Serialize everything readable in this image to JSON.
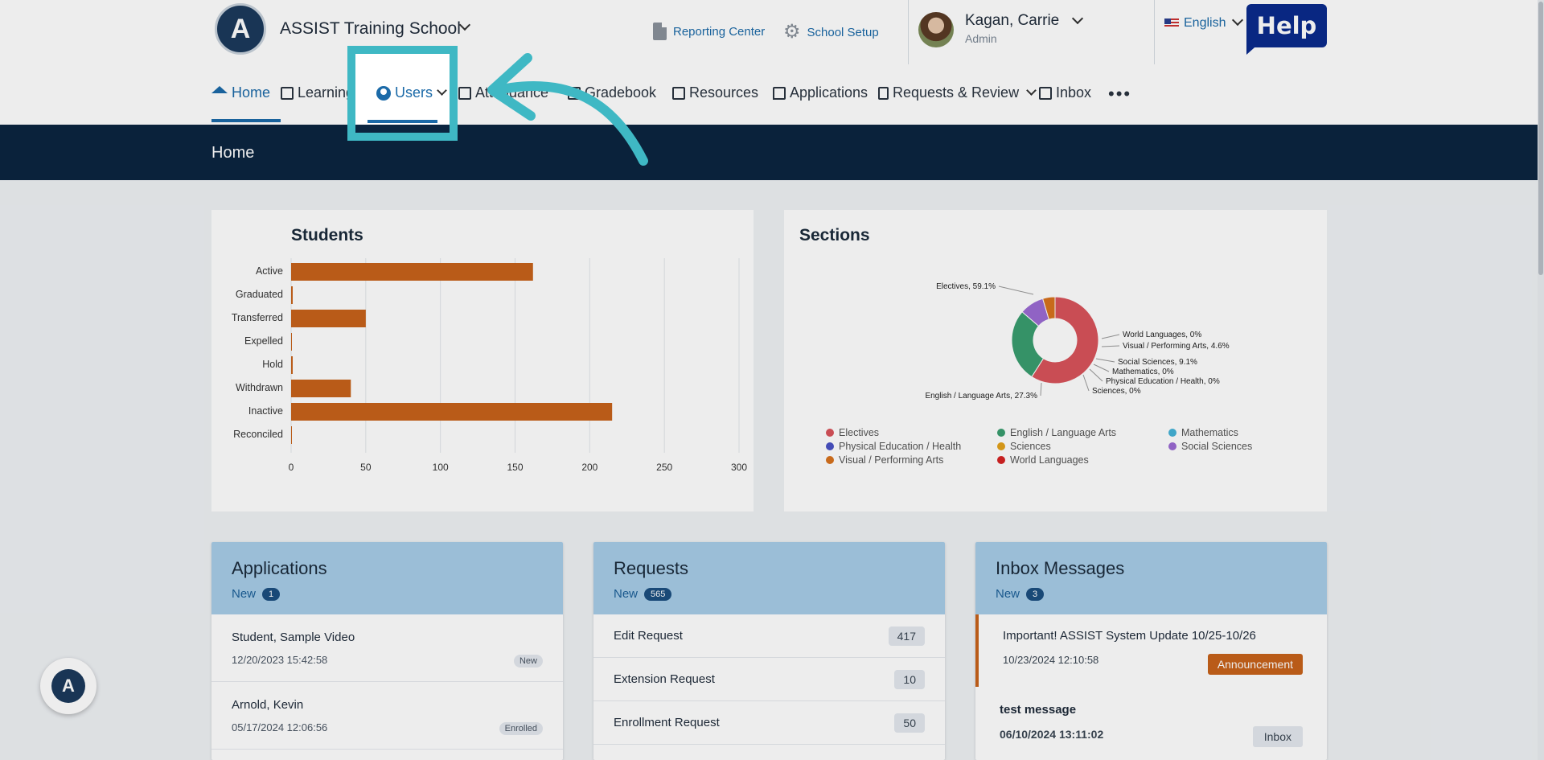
{
  "header": {
    "logo_letter": "A",
    "school_name": "ASSIST Training School",
    "reporting_center": "Reporting Center",
    "school_setup": "School Setup",
    "user_name": "Kagan, Carrie",
    "user_role": "Admin",
    "language": "English",
    "help": "Help"
  },
  "nav": {
    "home": "Home",
    "learning": "Learning",
    "users": "Users",
    "attendance": "Attendance",
    "gradebook": "Gradebook",
    "resources": "Resources",
    "applications": "Applications",
    "requests_review": "Requests & Review",
    "inbox": "Inbox",
    "more": "•••"
  },
  "page_title": "Home",
  "students_chart": {
    "title": "Students",
    "chart_data": {
      "type": "bar",
      "orientation": "horizontal",
      "categories": [
        "Active",
        "Graduated",
        "Transferred",
        "Expelled",
        "Hold",
        "Withdrawn",
        "Inactive",
        "Reconciled"
      ],
      "values": [
        162,
        1,
        50,
        0,
        1,
        40,
        215,
        0
      ],
      "xlim": [
        0,
        300
      ],
      "xticks": [
        "0",
        "50",
        "100",
        "150",
        "200",
        "250",
        "300"
      ],
      "bar_color": "#c8621a",
      "grid": true
    }
  },
  "sections_chart": {
    "title": "Sections",
    "chart_data": {
      "type": "pie",
      "donut": true,
      "slices": [
        {
          "name": "Electives",
          "value": 59.1,
          "label": "Electives, 59.1%",
          "color": "#d9535b"
        },
        {
          "name": "English / Language Arts",
          "value": 27.3,
          "label": "English / Language Arts, 27.3%",
          "color": "#3a9e6f"
        },
        {
          "name": "Mathematics",
          "value": 0,
          "label": "Mathematics, 0%",
          "color": "#45b3d8"
        },
        {
          "name": "Physical Education / Health",
          "value": 0,
          "label": "Physical Education / Health, 0%",
          "color": "#4a52c4"
        },
        {
          "name": "Sciences",
          "value": 0,
          "label": "Sciences, 0%",
          "color": "#e3a21a"
        },
        {
          "name": "Social Sciences",
          "value": 9.1,
          "label": "Social Sciences, 9.1%",
          "color": "#9b6bd3"
        },
        {
          "name": "Visual / Performing Arts",
          "value": 4.6,
          "label": "Visual / Performing Arts, 4.6%",
          "color": "#d8731e"
        },
        {
          "name": "World Languages",
          "value": 0,
          "label": "World Languages, 0%",
          "color": "#d52323"
        }
      ],
      "legend_placement": "bottom"
    }
  },
  "applications": {
    "title": "Applications",
    "new_label": "New",
    "new_count": "1",
    "items": [
      {
        "name": "Student, Sample Video",
        "date": "12/20/2023 15:42:58",
        "status": "New"
      },
      {
        "name": "Arnold, Kevin",
        "date": "05/17/2024 12:06:56",
        "status": "Enrolled"
      }
    ]
  },
  "requests": {
    "title": "Requests",
    "new_label": "New",
    "new_count": "565",
    "items": [
      {
        "name": "Edit Request",
        "count": "417"
      },
      {
        "name": "Extension Request",
        "count": "10"
      },
      {
        "name": "Enrollment Request",
        "count": "50"
      }
    ]
  },
  "inbox": {
    "title": "Inbox Messages",
    "new_label": "New",
    "new_count": "3",
    "items": [
      {
        "subject": "Important! ASSIST System Update 10/25-10/26",
        "date": "10/23/2024 12:10:58",
        "tag": "Announcement"
      },
      {
        "subject": "test message",
        "date": "06/10/2024 13:11:02",
        "tag": "Inbox"
      }
    ]
  },
  "colors": {
    "accent": "#1b6aa8",
    "navy": "#0b2540",
    "highlight": "#3fb8c4",
    "bar": "#c8621a"
  }
}
